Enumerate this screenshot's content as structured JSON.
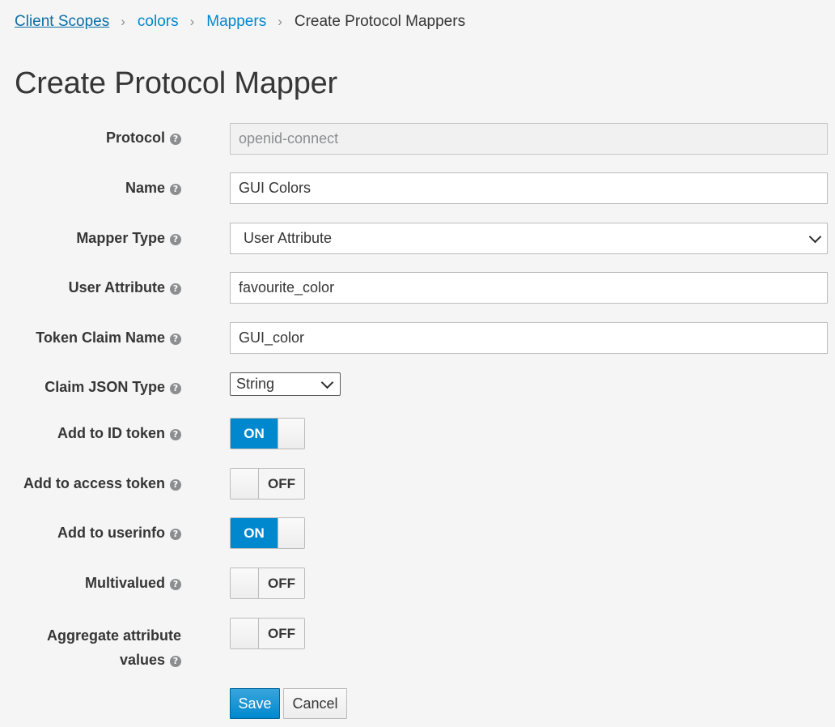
{
  "breadcrumb": {
    "items": [
      "Client Scopes",
      "colors",
      "Mappers"
    ],
    "current": "Create Protocol Mappers",
    "separator": "›"
  },
  "page_title": "Create Protocol Mapper",
  "help_glyph": "?",
  "form": {
    "protocol": {
      "label": "Protocol",
      "value": "openid-connect"
    },
    "name": {
      "label": "Name",
      "value": "GUI Colors"
    },
    "mapper_type": {
      "label": "Mapper Type",
      "value": "User Attribute"
    },
    "user_attribute": {
      "label": "User Attribute",
      "value": "favourite_color"
    },
    "token_claim_name": {
      "label": "Token Claim Name",
      "value": "GUI_color"
    },
    "claim_json_type": {
      "label": "Claim JSON Type",
      "value": "String"
    },
    "add_to_id_token": {
      "label": "Add to ID token",
      "state": "ON"
    },
    "add_to_access_token": {
      "label": "Add to access token",
      "state": "OFF"
    },
    "add_to_userinfo": {
      "label": "Add to userinfo",
      "state": "ON"
    },
    "multivalued": {
      "label": "Multivalued",
      "state": "OFF"
    },
    "aggregate_attribute_values": {
      "label_line1": "Aggregate attribute",
      "label_line2": "values",
      "state": "OFF"
    }
  },
  "buttons": {
    "save": "Save",
    "cancel": "Cancel"
  },
  "colors": {
    "accent": "#0088ce",
    "link": "#0088ce",
    "background": "#f5f5f5"
  }
}
